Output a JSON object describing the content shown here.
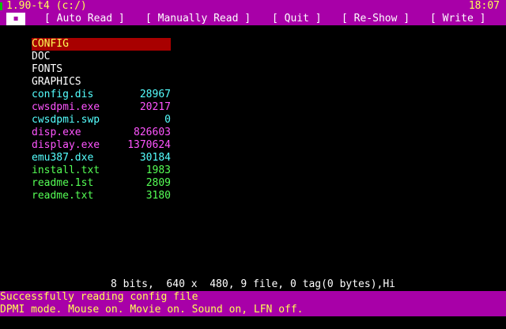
{
  "title_bar": {
    "app_title": "1.90-t4 (c:/)",
    "clock": "18:07"
  },
  "menu": {
    "icon_glyph": "▪",
    "items": [
      {
        "label": "[ Auto Read ]"
      },
      {
        "label": "[ Manually Read ]"
      },
      {
        "label": "[ Quit ]"
      },
      {
        "label": "[ Re-Show ]"
      },
      {
        "label": "[ Write ]"
      }
    ]
  },
  "files": [
    {
      "name": "CONFIG",
      "size": "",
      "color": "#ffffff",
      "selected": true
    },
    {
      "name": "DOC",
      "size": "",
      "color": "#ffffff"
    },
    {
      "name": "FONTS",
      "size": "",
      "color": "#ffffff"
    },
    {
      "name": "GRAPHICS",
      "size": "",
      "color": "#ffffff"
    },
    {
      "name": "config.dis",
      "size": "28967",
      "color": "#55ffff"
    },
    {
      "name": "cwsdpmi.exe",
      "size": "20217",
      "color": "#ff55ff"
    },
    {
      "name": "cwsdpmi.swp",
      "size": "0",
      "color": "#55ffff"
    },
    {
      "name": "disp.exe",
      "size": "826603",
      "color": "#ff55ff"
    },
    {
      "name": "display.exe",
      "size": "1370624",
      "color": "#ff55ff"
    },
    {
      "name": "emu387.dxe",
      "size": "30184",
      "color": "#55ffff"
    },
    {
      "name": "install.txt",
      "size": "1983",
      "color": "#55ff55"
    },
    {
      "name": "readme.1st",
      "size": "2809",
      "color": "#55ff55"
    },
    {
      "name": "readme.txt",
      "size": "3180",
      "color": "#55ff55"
    }
  ],
  "status": {
    "text": "8 bits,  640 x  480, 9 file, 0 tag(0 bytes),Hi"
  },
  "messages": {
    "line1": "Successfully reading config file",
    "line2": "DPMI mode. Mouse on. Movie on. Sound on, LFN off."
  },
  "colors": {
    "bar_bg": "#a800a8",
    "highlight_bg": "#a80000",
    "text_yellow": "#ffff55"
  }
}
